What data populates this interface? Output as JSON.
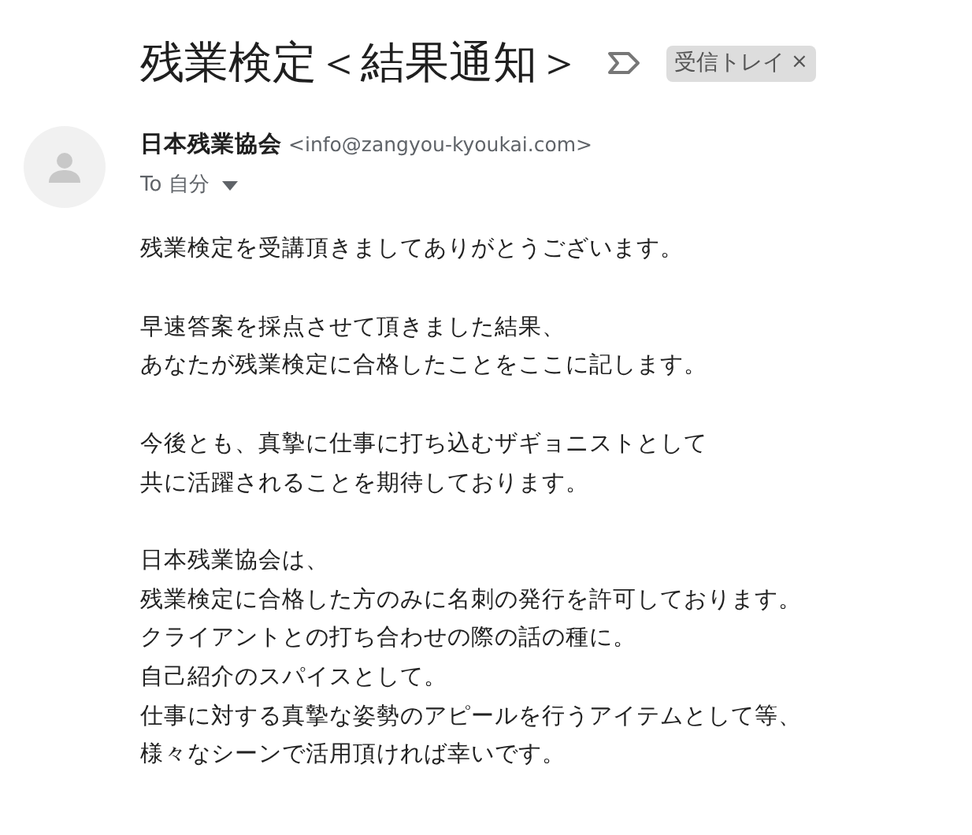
{
  "subject": "残業検定＜結果通知＞",
  "label": {
    "text": "受信トレイ",
    "close": "×"
  },
  "sender": {
    "name": "日本残業協会",
    "email": "<info@zangyou-kyoukai.com>"
  },
  "recipient": {
    "text": "To 自分"
  },
  "body": [
    {
      "lines": [
        "残業検定を受講頂きましてありがとうございます。"
      ]
    },
    {
      "lines": [
        "早速答案を採点させて頂きました結果、",
        "あなたが残業検定に合格したことをここに記します。"
      ]
    },
    {
      "lines": [
        "今後とも、真摯に仕事に打ち込むザギョニストとして",
        "共に活躍されることを期待しております。"
      ]
    },
    {
      "lines": [
        "日本残業協会は、",
        "残業検定に合格した方のみに名刺の発行を許可しております。",
        "クライアントとの打ち合わせの際の話の種に。",
        "自己紹介のスパイスとして。",
        "仕事に対する真摯な姿勢のアピールを行うアイテムとして等、",
        "様々なシーンで活用頂ければ幸いです。"
      ]
    }
  ]
}
